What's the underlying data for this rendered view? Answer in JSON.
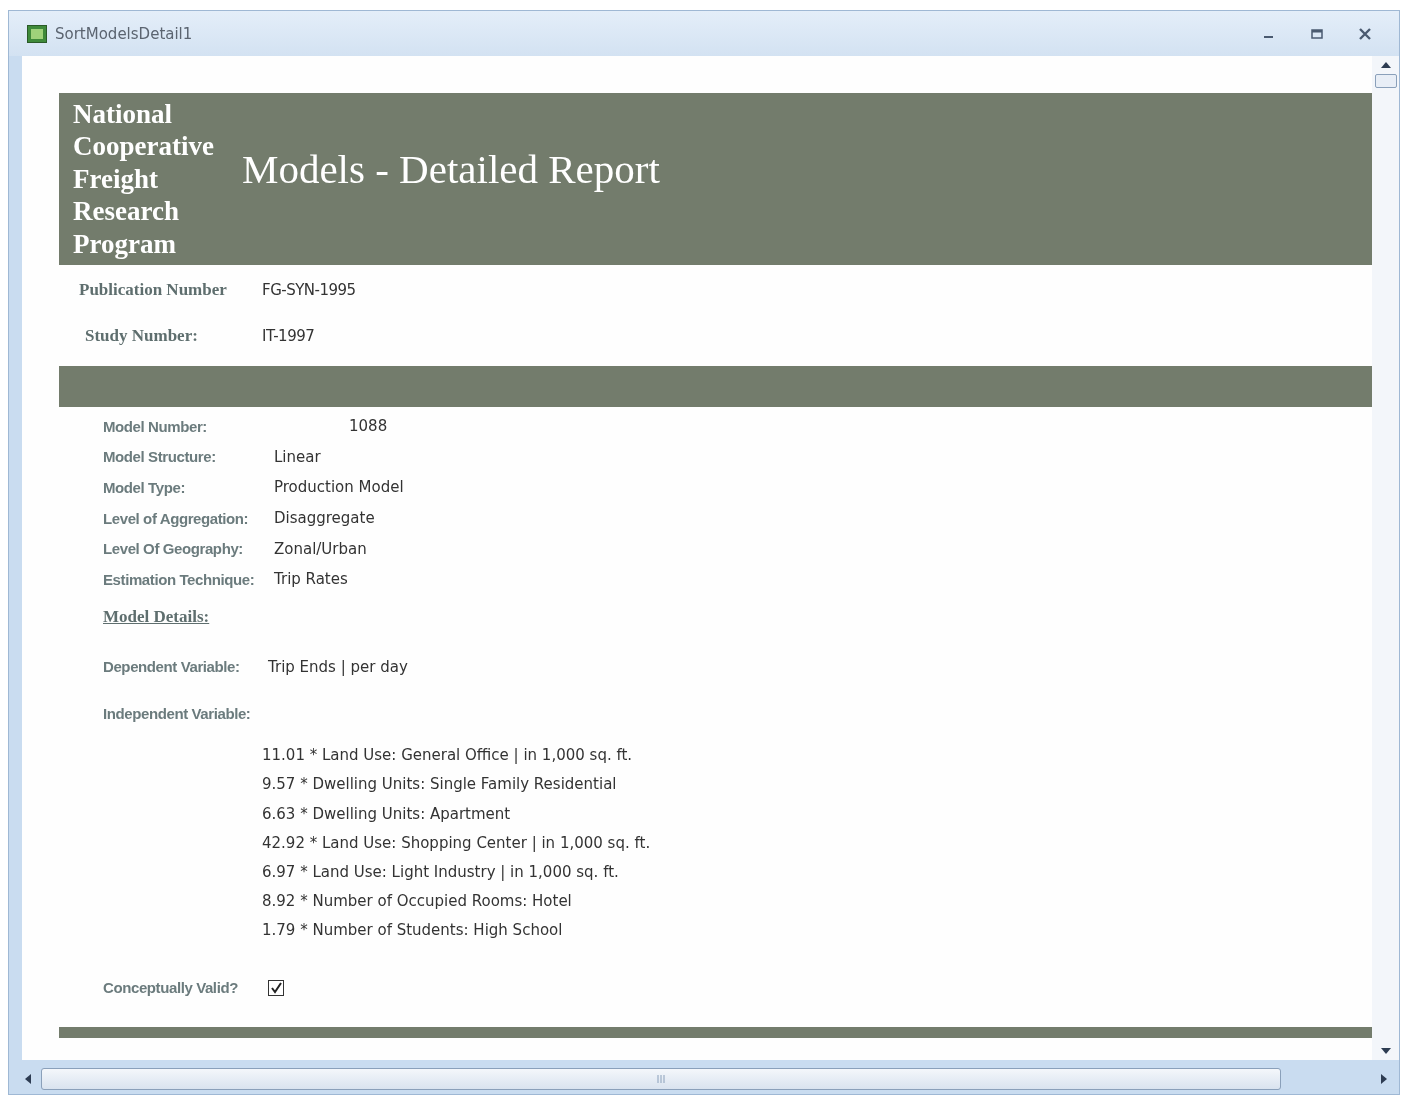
{
  "window": {
    "title": "SortModelsDetail1"
  },
  "header": {
    "organization": "National Cooperative Freight Research Program",
    "title": "Models - Detailed Report"
  },
  "publication": [
    {
      "label": "Publication Number",
      "value": "FG-SYN-1995"
    },
    {
      "label": "Study Number:",
      "value": "IT-1997"
    }
  ],
  "model_fields": [
    {
      "kind": "number",
      "label": "Model Number:",
      "value": "1088"
    },
    {
      "kind": "text",
      "label": "Model Structure:",
      "value": "Linear"
    },
    {
      "kind": "text",
      "label": "Model Type:",
      "value": "Production Model"
    },
    {
      "kind": "text",
      "label": "Level of Aggregation:",
      "value": "Disaggregate"
    },
    {
      "kind": "text",
      "label": "Level Of Geography:",
      "value": "Zonal/Urban"
    },
    {
      "kind": "text",
      "label": "Estimation Technique:",
      "value": "Trip Rates"
    }
  ],
  "model_details": {
    "heading": "Model Details:",
    "dependent_variable": {
      "label": "Dependent Variable:",
      "value": "Trip Ends | per day"
    },
    "independent_variable": {
      "label": "Independent Variable:",
      "terms": [
        "11.01 * Land Use: General Office | in 1,000 sq. ft.",
        "9.57 * Dwelling Units: Single Family Residential",
        "6.63 * Dwelling Units: Apartment",
        "42.92 * Land Use: Shopping Center | in 1,000 sq. ft.",
        "6.97 * Land Use: Light Industry | in 1,000 sq. ft.",
        "8.92 * Number of Occupied Rooms: Hotel",
        "1.79 * Number of Students: High School"
      ]
    },
    "conceptually_valid": {
      "label": "Conceptually Valid?",
      "checked": true
    }
  }
}
